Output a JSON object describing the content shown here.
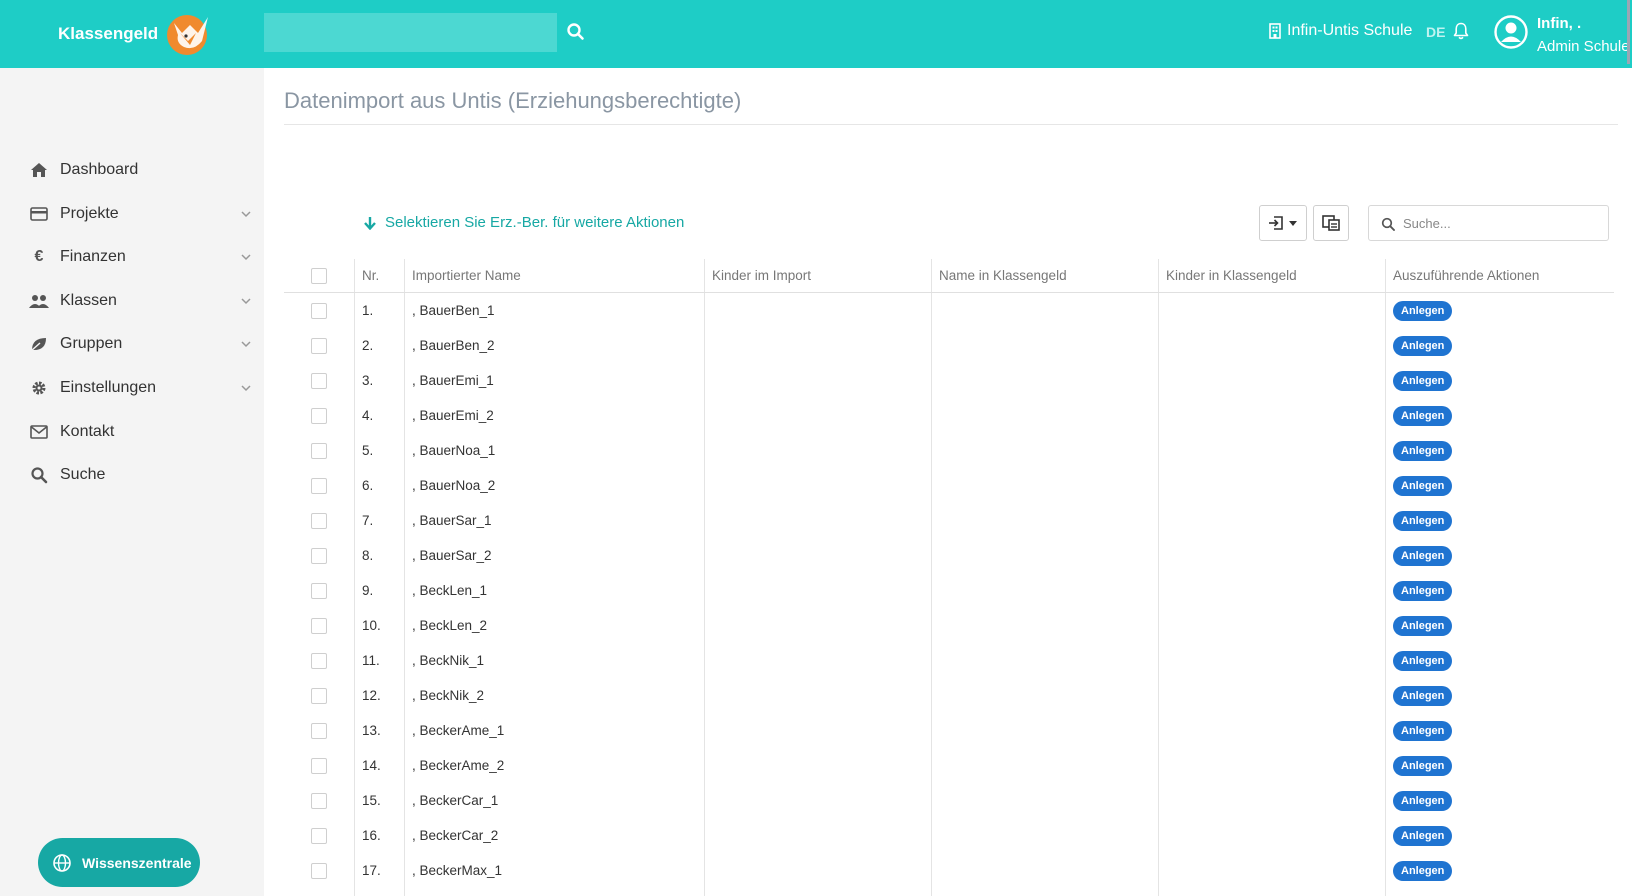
{
  "app": {
    "brand": "Klassengeld",
    "school": "Infin-Untis Schule",
    "language": "DE",
    "user": {
      "name": "Infin, .",
      "role": "Admin Schule"
    }
  },
  "sidebar": {
    "items": [
      {
        "label": "Dashboard",
        "icon": "home-icon",
        "expandable": false
      },
      {
        "label": "Projekte",
        "icon": "credit-card-icon",
        "expandable": true
      },
      {
        "label": "Finanzen",
        "icon": "euro-icon",
        "expandable": true
      },
      {
        "label": "Klassen",
        "icon": "users-icon",
        "expandable": true
      },
      {
        "label": "Gruppen",
        "icon": "leaf-icon",
        "expandable": true
      },
      {
        "label": "Einstellungen",
        "icon": "gear-icon",
        "expandable": true
      },
      {
        "label": "Kontakt",
        "icon": "envelope-icon",
        "expandable": false
      },
      {
        "label": "Suche",
        "icon": "search-icon",
        "expandable": false
      }
    ],
    "help_button": "Wissenszentrale"
  },
  "main": {
    "title": "Datenimport aus Untis (Erziehungsberechtigte)",
    "select_hint": "Selektieren Sie Erz.-Ber. für weitere Aktionen",
    "search_placeholder": "Suche...",
    "columns": {
      "nr": "Nr.",
      "imported_name": "Importierter Name",
      "children_import": "Kinder im Import",
      "name_kg": "Name in Klassengeld",
      "children_kg": "Kinder in Klassengeld",
      "actions": "Auszuführende Aktionen"
    },
    "rows": [
      {
        "nr": "1.",
        "name": ", BauerBen_1",
        "action": "Anlegen"
      },
      {
        "nr": "2.",
        "name": ", BauerBen_2",
        "action": "Anlegen"
      },
      {
        "nr": "3.",
        "name": ", BauerEmi_1",
        "action": "Anlegen"
      },
      {
        "nr": "4.",
        "name": ", BauerEmi_2",
        "action": "Anlegen"
      },
      {
        "nr": "5.",
        "name": ", BauerNoa_1",
        "action": "Anlegen"
      },
      {
        "nr": "6.",
        "name": ", BauerNoa_2",
        "action": "Anlegen"
      },
      {
        "nr": "7.",
        "name": ", BauerSar_1",
        "action": "Anlegen"
      },
      {
        "nr": "8.",
        "name": ", BauerSar_2",
        "action": "Anlegen"
      },
      {
        "nr": "9.",
        "name": ", BeckLen_1",
        "action": "Anlegen"
      },
      {
        "nr": "10.",
        "name": ", BeckLen_2",
        "action": "Anlegen"
      },
      {
        "nr": "11.",
        "name": ", BeckNik_1",
        "action": "Anlegen"
      },
      {
        "nr": "12.",
        "name": ", BeckNik_2",
        "action": "Anlegen"
      },
      {
        "nr": "13.",
        "name": ", BeckerAme_1",
        "action": "Anlegen"
      },
      {
        "nr": "14.",
        "name": ", BeckerAme_2",
        "action": "Anlegen"
      },
      {
        "nr": "15.",
        "name": ", BeckerCar_1",
        "action": "Anlegen"
      },
      {
        "nr": "16.",
        "name": ", BeckerCar_2",
        "action": "Anlegen"
      },
      {
        "nr": "17.",
        "name": ", BeckerMax_1",
        "action": "Anlegen"
      }
    ]
  },
  "colors": {
    "header": "#1ecdc6",
    "accent": "#17a8a4",
    "badge": "#1f74d1",
    "sidebar_bg": "#f4f4f4"
  }
}
